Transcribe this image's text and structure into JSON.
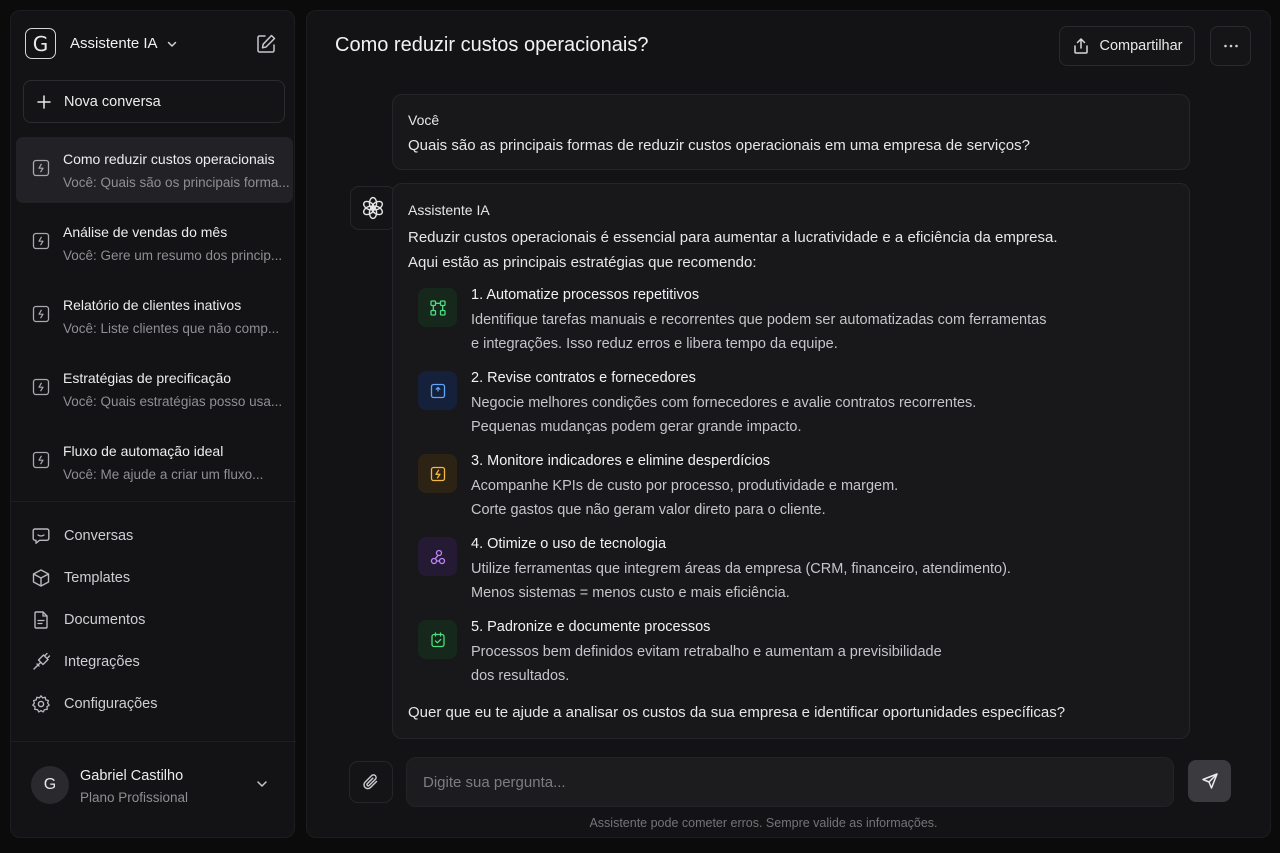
{
  "app": {
    "logo_letter": "G",
    "name": "Assistente IA",
    "new_chat_label": "Nova conversa"
  },
  "conversations": [
    {
      "title": "Como reduzir custos operacionais",
      "snippet": "Você: Quais são os principais forma...",
      "active": true
    },
    {
      "title": "Análise de vendas do mês",
      "snippet": "Você: Gere um resumo dos princip...",
      "active": false
    },
    {
      "title": "Relatório de clientes inativos",
      "snippet": "Você: Liste clientes que não comp...",
      "active": false
    },
    {
      "title": "Estratégias de precificação",
      "snippet": "Você: Quais estratégias posso usa...",
      "active": false
    },
    {
      "title": "Fluxo de automação ideal",
      "snippet": "Você: Me ajude a criar um fluxo...",
      "active": false
    }
  ],
  "nav": [
    {
      "label": "Conversas",
      "icon": "chat-bubble-icon"
    },
    {
      "label": "Templates",
      "icon": "cube-icon"
    },
    {
      "label": "Documentos",
      "icon": "document-icon"
    },
    {
      "label": "Integrações",
      "icon": "plug-icon"
    },
    {
      "label": "Configurações",
      "icon": "gear-icon"
    }
  ],
  "user": {
    "initial": "G",
    "name": "Gabriel Castilho",
    "plan": "Plano Profissional"
  },
  "header": {
    "title": "Como reduzir custos operacionais?",
    "share_label": "Compartilhar"
  },
  "user_message": {
    "author": "Você",
    "text": "Quais são as principais formas de reduzir custos operacionais em uma empresa de serviços?"
  },
  "assistant_message": {
    "author": "Assistente IA",
    "intro_line1": "Reduzir custos operacionais é essencial para aumentar a lucratividade e a eficiência da empresa.",
    "intro_line2": "Aqui estão as principais estratégias que recomendo:",
    "steps": [
      {
        "title": "1. Automatize processos repetitivos",
        "line1": "Identifique tarefas manuais e recorrentes que podem ser automatizadas com ferramentas",
        "line2": "e integrações. Isso reduz erros e libera tempo da equipe.",
        "icon": "workflow-icon",
        "color": "#4ade80",
        "bg": "#16281c"
      },
      {
        "title": "2. Revise contratos e fornecedores",
        "line1": "Negocie melhores condições com fornecedores e avalie contratos recorrentes.",
        "line2": "Pequenas mudanças podem gerar grande impacto.",
        "icon": "contract-icon",
        "color": "#60a5fa",
        "bg": "#15213a"
      },
      {
        "title": "3. Monitore indicadores e elimine desperdícios",
        "line1": "Acompanhe KPIs de custo por processo, produtividade e margem.",
        "line2": "Corte gastos que não geram valor direto para o cliente.",
        "icon": "lightning-icon",
        "color": "#f5b942",
        "bg": "#2c2314"
      },
      {
        "title": "4. Otimize o uso de tecnologia",
        "line1": "Utilize ferramentas que integrem áreas da empresa (CRM, financeiro, atendimento).",
        "line2": "Menos sistemas = menos custo e mais eficiência.",
        "icon": "integration-icon",
        "color": "#c084fc",
        "bg": "#241a33"
      },
      {
        "title": "5. Padronize e documente processos",
        "line1": "Processos bem definidos evitam retrabalho e aumentam a previsibilidade",
        "line2": "dos resultados.",
        "icon": "checklist-icon",
        "color": "#4ade80",
        "bg": "#16281c"
      }
    ],
    "outro": "Quer que eu te ajude a analisar os custos da sua empresa e identificar oportunidades específicas?"
  },
  "composer": {
    "placeholder": "Digite sua pergunta...",
    "value": ""
  },
  "disclaimer": "Assistente pode cometer erros. Sempre valide as informações."
}
